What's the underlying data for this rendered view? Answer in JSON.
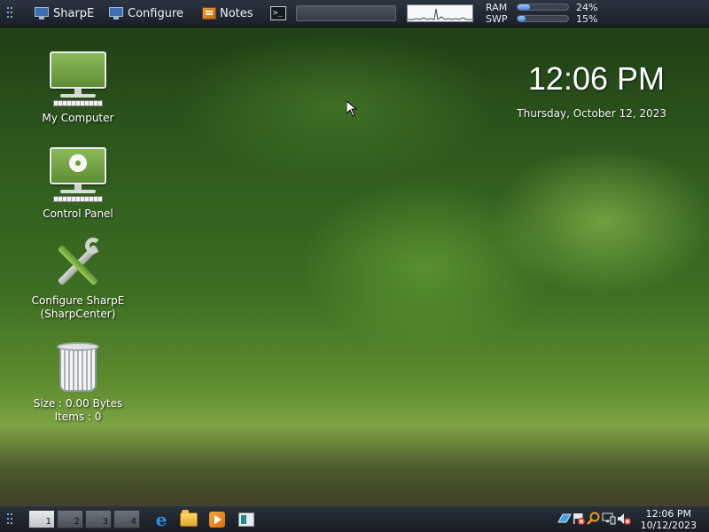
{
  "top_panel": {
    "items": [
      {
        "label": "SharpE",
        "icon": "monitor-icon"
      },
      {
        "label": "Configure",
        "icon": "monitor-icon"
      },
      {
        "label": "Notes",
        "icon": "notes-icon"
      }
    ],
    "terminal_icon": "terminal-icon",
    "search_placeholder": "",
    "meters": {
      "ram": {
        "label": "RAM",
        "percent_text": "24%",
        "percent": 24
      },
      "swp": {
        "label": "SWP",
        "percent_text": "15%",
        "percent": 15
      }
    }
  },
  "clock_widget": {
    "time": "12:06 PM",
    "date": "Thursday, October 12, 2023"
  },
  "desktop_icons": {
    "my_computer": {
      "label": "My Computer"
    },
    "control_panel": {
      "label": "Control Panel"
    },
    "configure_sharpe": {
      "label_line1": "Configure SharpE",
      "label_line2": "(SharpCenter)"
    },
    "trash": {
      "size_text": "Size : 0.00 Bytes",
      "items_text": "Items : 0"
    }
  },
  "taskbar": {
    "workspaces": [
      {
        "label": "1",
        "active": true
      },
      {
        "label": "2",
        "active": false
      },
      {
        "label": "3",
        "active": false
      },
      {
        "label": "4",
        "active": false
      }
    ],
    "apps": [
      "internet-explorer-icon",
      "folder-icon",
      "media-player-icon",
      "window-icon"
    ],
    "tray_icons": [
      "network-icon",
      "flag-icon",
      "search-icon",
      "monitor-icon",
      "volume-muted-icon"
    ],
    "clock": {
      "time": "12:06 PM",
      "date": "10/12/2023"
    }
  },
  "colors": {
    "panel": "#1a1f27",
    "meter_fill": "#4a8ee0",
    "clock_text": "#ffffff"
  }
}
